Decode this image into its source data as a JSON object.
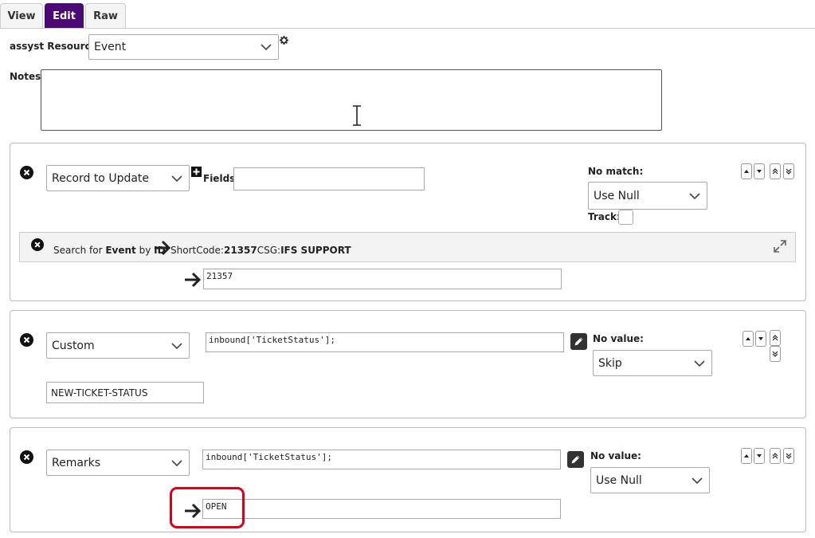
{
  "tabs": [
    {
      "label": "View",
      "active": false
    },
    {
      "label": "Edit",
      "active": true
    },
    {
      "label": "Raw",
      "active": false
    }
  ],
  "resource": {
    "label": "assyst Resource:",
    "value": "Event",
    "settings_icon": "gear-icon"
  },
  "notes": {
    "label": "Notes:",
    "value": ""
  },
  "rule1": {
    "type": "Record to Update",
    "fields_label": "Fields:",
    "fields_value": "",
    "no_match_label": "No match:",
    "no_match_value": "Use Null",
    "track_label": "Track:",
    "search": {
      "prefix": "Search for ",
      "entity": "Event",
      "by": " by ",
      "method": "ID",
      "detail_prefix": "ShortCode:",
      "shortcode": "21357",
      "csg_prefix": "CSG:",
      "csg": "IFS SUPPORT"
    },
    "id_value": "21357"
  },
  "rule2": {
    "type": "Custom",
    "expression": "inbound['TicketStatus'];",
    "no_value_label": "No value:",
    "no_value_value": "Skip",
    "target_field": "NEW-TICKET-STATUS"
  },
  "rule3": {
    "type": "Remarks",
    "expression": "inbound['TicketStatus'];",
    "no_value_label": "No value:",
    "no_value_value": "Use Null",
    "output_value": "OPEN"
  },
  "colors": {
    "accent": "#4b0a73",
    "highlight": "#d9001b"
  }
}
